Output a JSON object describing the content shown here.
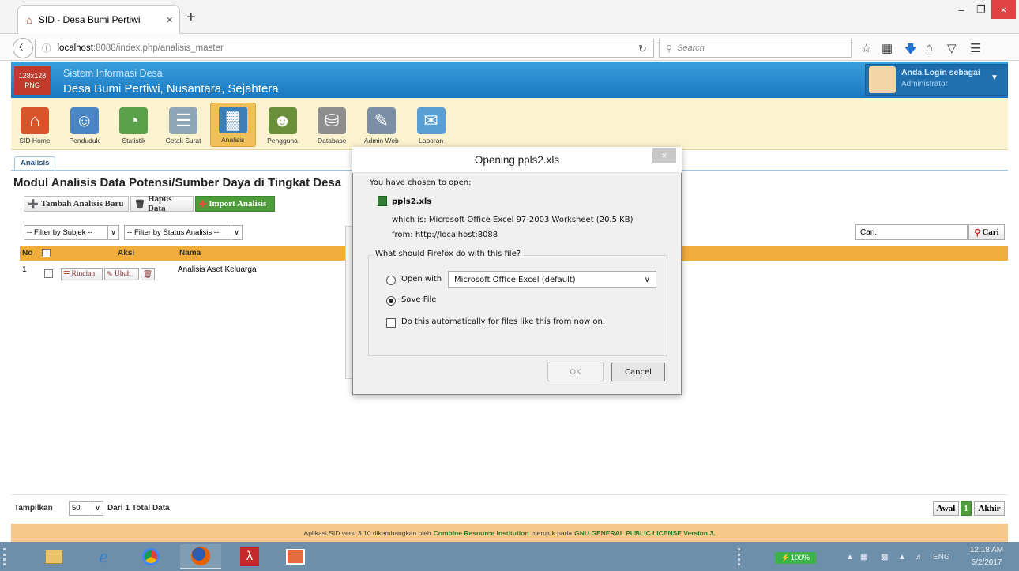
{
  "browser": {
    "tab_title": "SID - Desa Bumi Pertiwi",
    "url_host": "localhost",
    "url_path": ":8088/index.php/analisis_master",
    "search_placeholder": "Search"
  },
  "site": {
    "logo_text": "128x128 PNG",
    "title_small": "Sistem Informasi Desa",
    "title_large": "Desa Bumi Pertiwi, Nusantara, Sejahtera",
    "user_label": "Anda Login sebagai",
    "user_role": "Administrator"
  },
  "toolbar": [
    {
      "label": "SID Home",
      "icon": "home-icon",
      "color": "#d9542b"
    },
    {
      "label": "Penduduk",
      "icon": "people-icon",
      "color": "#4a86c5"
    },
    {
      "label": "Statistik",
      "icon": "pie-chart-icon",
      "color": "#5aa04a"
    },
    {
      "label": "Cetak Surat",
      "icon": "document-icon",
      "color": "#8fa6b8"
    },
    {
      "label": "Analisis",
      "icon": "analysis-icon",
      "color": "#3d7fb7"
    },
    {
      "label": "Pengguna",
      "icon": "users-icon",
      "color": "#6a8f3b"
    },
    {
      "label": "Database",
      "icon": "database-icon",
      "color": "#8e8e8e"
    },
    {
      "label": "Admin Web",
      "icon": "admin-web-icon",
      "color": "#7a8fa6"
    },
    {
      "label": "Laporan",
      "icon": "mail-icon",
      "color": "#5a9fd4"
    }
  ],
  "page": {
    "subtab": "Analisis",
    "title": "Modul Analisis Data Potensi/Sumber Daya di Tingkat Desa",
    "add_button": "Tambah Analisis Baru",
    "delete_button": "Hapus Data",
    "import_button": "Import Analisis",
    "filter_subject": "-- Filter by Subjek --",
    "filter_status": "-- Filter by Status Analisis --",
    "search_placeholder": "Cari..",
    "search_button": "Cari",
    "columns": {
      "no": "No",
      "aksi": "Aksi",
      "nama": "Nama"
    },
    "rows": [
      {
        "no": "1",
        "detail_button": "Rincian",
        "edit_button": "Ubah",
        "name": "Analisis Aset Keluarga"
      }
    ],
    "show_label": "Tampilkan",
    "page_size": "50",
    "total_prefix": "Dari",
    "total_count": "1",
    "total_suffix": "Total Data",
    "first_button": "Awal",
    "current_page": "1",
    "last_button": "Akhir"
  },
  "footer": {
    "text1": "Aplikasi SID versi 3.10 dikembangkan oleh",
    "org": "Combine Resource Institution",
    "text2": "merujuk pada",
    "license": "GNU GENERAL PUBLIC LICENSE Version 3."
  },
  "dialog": {
    "title": "Opening ppls2.xls",
    "chosen_label": "You have chosen to open:",
    "filename": "ppls2.xls",
    "which_is": "which is:  Microsoft Office Excel 97-2003 Worksheet (20.5 KB)",
    "from": "from:  http://localhost:8088",
    "question": "What should Firefox do with this file?",
    "open_with_label": "Open with",
    "open_with_app": "Microsoft Office Excel (default)",
    "save_file_label": "Save File",
    "auto_label": "Do this automatically for files like this from now on.",
    "ok": "OK",
    "cancel": "Cancel",
    "selected_option": "save"
  },
  "taskbar": {
    "battery": "100%",
    "lang": "ENG",
    "time": "12:18 AM",
    "date": "5/2/2017"
  }
}
